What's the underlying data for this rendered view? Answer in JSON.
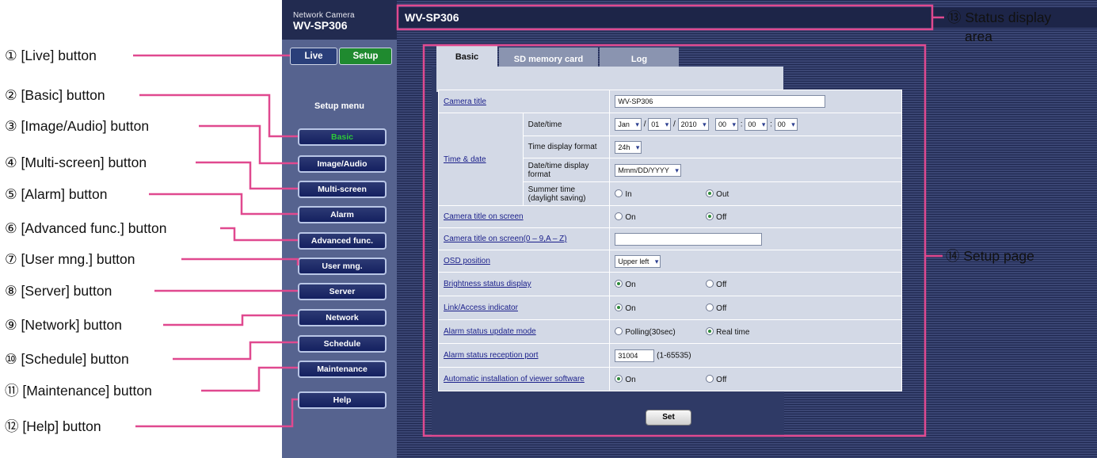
{
  "annotations": {
    "left": [
      "① [Live] button",
      "② [Basic] button",
      "③ [Image/Audio] button",
      "④ [Multi-screen] button",
      "⑤ [Alarm] button",
      "⑥ [Advanced func.] button",
      "⑦ [User mng.] button",
      "⑧ [Server] button",
      "⑨ [Network] button",
      "⑩ [Schedule] button",
      "⑪ [Maintenance] button",
      "⑫ [Help] button"
    ],
    "status_line1": "⑬ Status display",
    "status_line2": "area",
    "setup_page": "⑭ Setup page"
  },
  "camera": {
    "brand_line1": "Network Camera",
    "brand_line2": "WV-SP306",
    "status_title": "WV-SP306",
    "live_label": "Live",
    "setup_label": "Setup",
    "menu_title": "Setup menu",
    "menu": [
      "Basic",
      "Image/Audio",
      "Multi-screen",
      "Alarm",
      "Advanced func.",
      "User mng.",
      "Server",
      "Network",
      "Schedule",
      "Maintenance",
      "Help"
    ]
  },
  "tabs": [
    "Basic",
    "SD memory card",
    "Log"
  ],
  "form": {
    "camera_title_label": "Camera title",
    "camera_title_value": "WV-SP306",
    "time_date_label": "Time & date",
    "datetime_label": "Date/time",
    "month": "Jan",
    "day": "01",
    "year": "2010",
    "hour": "00",
    "minute": "00",
    "second": "00",
    "slash": "/",
    "colon": ":",
    "time_format_label": "Time display format",
    "time_format_value": "24h",
    "date_format_label": "Date/time display format",
    "date_format_value": "Mmm/DD/YYYY",
    "summer_label": "Summer time (daylight saving)",
    "summer_in": "In",
    "summer_out": "Out",
    "title_on_screen_label": "Camera title on screen",
    "title_on_screen_on": "On",
    "title_on_screen_off": "Off",
    "title_on_screen2_label": "Camera title on screen(0 – 9,A – Z)",
    "title_on_screen2_value": "",
    "osd_label": "OSD position",
    "osd_value": "Upper left",
    "brightness_label": "Brightness status display",
    "brightness_on": "On",
    "brightness_off": "Off",
    "link_label": "Link/Access indicator",
    "link_on": "On",
    "link_off": "Off",
    "alarm_mode_label": "Alarm status update mode",
    "alarm_mode_polling": "Polling(30sec)",
    "alarm_mode_realtime": "Real time",
    "alarm_port_label": "Alarm status reception port",
    "alarm_port_value": "31004",
    "alarm_port_range": "(1-65535)",
    "auto_install_label": "Automatic installation of viewer software",
    "auto_install_on": "On",
    "auto_install_off": "Off",
    "set_label": "Set"
  },
  "colors": {
    "callout": "#e0498f",
    "sidebar": "#56638f",
    "panel": "#d3d9e6"
  }
}
